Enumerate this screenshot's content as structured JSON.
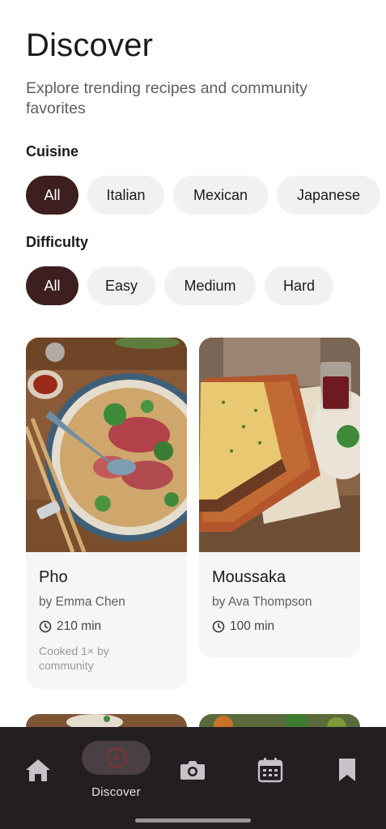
{
  "header": {
    "title": "Discover",
    "subtitle": "Explore trending recipes and community favorites"
  },
  "filters": {
    "cuisine": {
      "label": "Cuisine",
      "options": [
        "All",
        "Italian",
        "Mexican",
        "Japanese"
      ],
      "selected": "All"
    },
    "difficulty": {
      "label": "Difficulty",
      "options": [
        "All",
        "Easy",
        "Medium",
        "Hard"
      ],
      "selected": "All"
    }
  },
  "recipes": [
    {
      "title": "Pho",
      "author": "by Emma Chen",
      "time": "210 min",
      "community": "Cooked 1× by community",
      "image": "pho-bowl-photo"
    },
    {
      "title": "Moussaka",
      "author": "by Ava Thompson",
      "time": "100 min",
      "image": "moussaka-dish-photo"
    }
  ],
  "bottom_nav": {
    "items": [
      {
        "name": "home",
        "icon": "home-icon",
        "label": ""
      },
      {
        "name": "discover",
        "icon": "compass-icon",
        "label": "Discover",
        "active": true
      },
      {
        "name": "camera",
        "icon": "camera-icon",
        "label": ""
      },
      {
        "name": "calendar",
        "icon": "calendar-icon",
        "label": ""
      },
      {
        "name": "saved",
        "icon": "bookmark-icon",
        "label": ""
      }
    ]
  },
  "colors": {
    "selected_chip": "#3d1f1f",
    "chip": "#f1f1f1",
    "card": "#f6f6f6",
    "nav_bg": "#221e22",
    "nav_pill": "#4a3f45",
    "compass_accent": "#7a3535"
  }
}
